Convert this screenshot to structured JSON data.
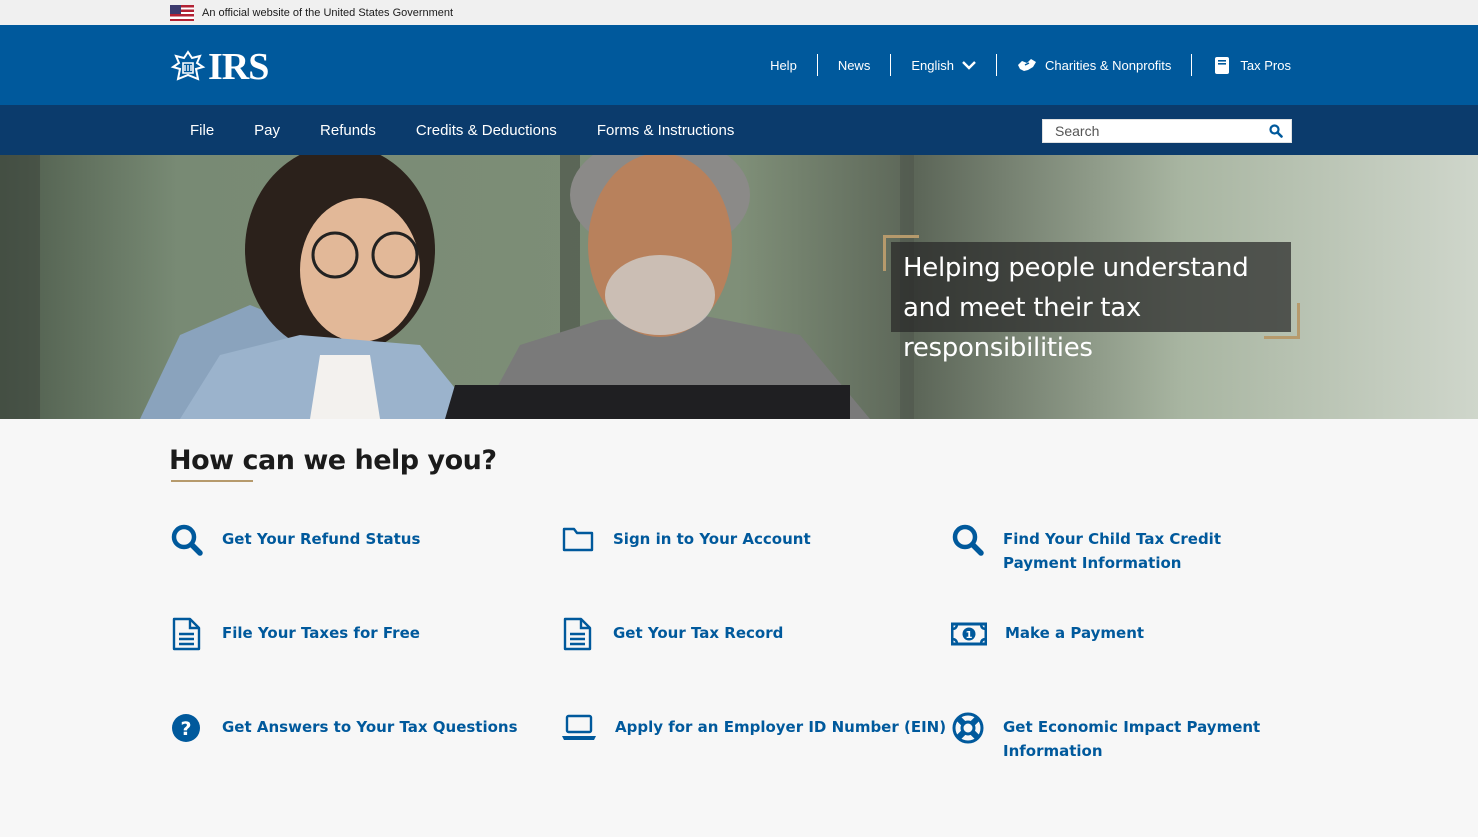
{
  "gov_banner": {
    "text": "An official website of the United States Government"
  },
  "header": {
    "logo_text": "IRS",
    "utility": [
      {
        "label": "Help"
      },
      {
        "label": "News"
      },
      {
        "label": "English"
      },
      {
        "label": "Charities & Nonprofits"
      },
      {
        "label": "Tax Pros"
      }
    ]
  },
  "nav": {
    "items": [
      "File",
      "Pay",
      "Refunds",
      "Credits & Deductions",
      "Forms & Instructions"
    ],
    "search_placeholder": "Search"
  },
  "hero": {
    "caption": "Helping people understand and meet their tax responsibilities"
  },
  "help": {
    "title": "How can we help you?",
    "tiles": [
      {
        "label": "Get Your Refund Status",
        "icon": "search-icon"
      },
      {
        "label": "Sign in to Your Account",
        "icon": "folder-icon"
      },
      {
        "label": "Find Your Child Tax Credit Payment Information",
        "icon": "search-icon"
      },
      {
        "label": "File Your Taxes for Free",
        "icon": "document-icon"
      },
      {
        "label": "Get Your Tax Record",
        "icon": "document-icon"
      },
      {
        "label": "Make a Payment",
        "icon": "money-icon"
      },
      {
        "label": "Get Answers to Your Tax Questions",
        "icon": "question-icon"
      },
      {
        "label": "Apply for an Employer ID Number (EIN)",
        "icon": "laptop-icon"
      },
      {
        "label": "Get Economic Impact Payment Information",
        "icon": "lifebuoy-icon"
      }
    ]
  },
  "colors": {
    "header_blue": "#00599c",
    "nav_navy": "#0b3b6c",
    "link_blue": "#00599c",
    "accent_gold": "#b69a6c"
  }
}
